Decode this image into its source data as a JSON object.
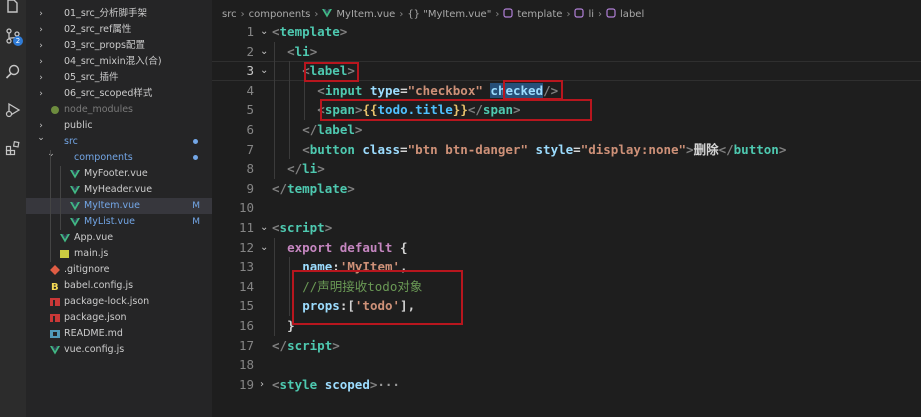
{
  "activity_bar": {
    "items": [
      {
        "name": "explorer-icon"
      },
      {
        "name": "source-control-icon",
        "badge": "2"
      },
      {
        "name": "search-icon"
      },
      {
        "name": "run-debug-icon"
      },
      {
        "name": "extensions-icon"
      }
    ]
  },
  "explorer": {
    "items": [
      {
        "label": "01_src_分析脚手架",
        "type": "folder",
        "depth": 0,
        "open": false
      },
      {
        "label": "02_src_ref属性",
        "type": "folder",
        "depth": 0,
        "open": false
      },
      {
        "label": "03_src_props配置",
        "type": "folder",
        "depth": 0,
        "open": false
      },
      {
        "label": "04_src_mixin混入(合)",
        "type": "folder",
        "depth": 0,
        "open": false
      },
      {
        "label": "05_src_插件",
        "type": "folder",
        "depth": 0,
        "open": false
      },
      {
        "label": "06_src_scoped样式",
        "type": "folder",
        "depth": 0,
        "open": false
      },
      {
        "label": "node_modules",
        "type": "node_modules",
        "depth": 0,
        "open": false,
        "dim": true
      },
      {
        "label": "public",
        "type": "folder",
        "depth": 0,
        "open": false
      },
      {
        "label": "src",
        "type": "folder",
        "depth": 0,
        "open": true,
        "color": "#73a6e6",
        "dot": true
      },
      {
        "label": "components",
        "type": "folder",
        "depth": 1,
        "open": true,
        "color": "#73a6e6",
        "dot": true
      },
      {
        "label": "MyFooter.vue",
        "type": "vue",
        "depth": 2
      },
      {
        "label": "MyHeader.vue",
        "type": "vue",
        "depth": 2
      },
      {
        "label": "MyItem.vue",
        "type": "vue",
        "depth": 2,
        "selected": true,
        "color": "#73a6e6",
        "badge": "M"
      },
      {
        "label": "MyList.vue",
        "type": "vue",
        "depth": 2,
        "color": "#73a6e6",
        "badge": "M"
      },
      {
        "label": "App.vue",
        "type": "vue",
        "depth": 1
      },
      {
        "label": "main.js",
        "type": "js",
        "depth": 1
      },
      {
        "label": ".gitignore",
        "type": "git",
        "depth": 0
      },
      {
        "label": "babel.config.js",
        "type": "babel",
        "depth": 0
      },
      {
        "label": "package-lock.json",
        "type": "npm",
        "depth": 0
      },
      {
        "label": "package.json",
        "type": "npm",
        "depth": 0
      },
      {
        "label": "README.md",
        "type": "md",
        "depth": 0
      },
      {
        "label": "vue.config.js",
        "type": "vue",
        "depth": 0
      }
    ]
  },
  "breadcrumb": {
    "parts": [
      "src",
      "components",
      "MyItem.vue",
      "{} \"MyItem.vue\"",
      "template",
      "li",
      "label"
    ]
  },
  "editor": {
    "current_line": "3",
    "lines": [
      {
        "n": "1",
        "fold": "⌄",
        "indent": 0,
        "tokens": [
          [
            "pun",
            "<"
          ],
          [
            "tag",
            "template"
          ],
          [
            "pun",
            ">"
          ]
        ]
      },
      {
        "n": "2",
        "fold": "⌄",
        "indent": 1,
        "tokens": [
          [
            "pun",
            "<"
          ],
          [
            "tag",
            "li"
          ],
          [
            "pun",
            ">"
          ]
        ]
      },
      {
        "n": "3",
        "fold": "⌄",
        "indent": 2,
        "tokens": [
          [
            "pun",
            "<"
          ],
          [
            "tag",
            "label"
          ],
          [
            "pun",
            ">"
          ]
        ]
      },
      {
        "n": "4",
        "fold": "",
        "indent": 3,
        "tokens": [
          [
            "pun",
            "<"
          ],
          [
            "tag",
            "input "
          ],
          [
            "attr",
            "type"
          ],
          [
            "wh",
            "="
          ],
          [
            "str",
            "\"checkbox\" "
          ],
          [
            "attrsel",
            "checked"
          ],
          [
            "pun",
            "/>"
          ]
        ]
      },
      {
        "n": "5",
        "fold": "",
        "indent": 3,
        "tokens": [
          [
            "pun",
            "<"
          ],
          [
            "tag",
            "span"
          ],
          [
            "pun",
            ">"
          ],
          [
            "brace",
            "{{"
          ],
          [
            "mus",
            "todo.title"
          ],
          [
            "brace",
            "}}"
          ],
          [
            "pun",
            "</"
          ],
          [
            "tag",
            "span"
          ],
          [
            "pun",
            ">"
          ]
        ]
      },
      {
        "n": "6",
        "fold": "",
        "indent": 2,
        "tokens": [
          [
            "pun",
            "</"
          ],
          [
            "tag",
            "label"
          ],
          [
            "pun",
            ">"
          ]
        ]
      },
      {
        "n": "7",
        "fold": "",
        "indent": 2,
        "tokens": [
          [
            "pun",
            "<"
          ],
          [
            "tag",
            "button "
          ],
          [
            "attr",
            "class"
          ],
          [
            "wh",
            "="
          ],
          [
            "str",
            "\"btn btn-danger\" "
          ],
          [
            "attr",
            "style"
          ],
          [
            "wh",
            "="
          ],
          [
            "str",
            "\"display:none\""
          ],
          [
            "pun",
            ">"
          ],
          [
            "wh",
            "删除"
          ],
          [
            "pun",
            "</"
          ],
          [
            "tag",
            "button"
          ],
          [
            "pun",
            ">"
          ]
        ]
      },
      {
        "n": "8",
        "fold": "",
        "indent": 1,
        "tokens": [
          [
            "pun",
            "</"
          ],
          [
            "tag",
            "li"
          ],
          [
            "pun",
            ">"
          ]
        ]
      },
      {
        "n": "9",
        "fold": "",
        "indent": 0,
        "tokens": [
          [
            "pun",
            "</"
          ],
          [
            "tag",
            "template"
          ],
          [
            "pun",
            ">"
          ]
        ]
      },
      {
        "n": "10",
        "fold": "",
        "indent": 0,
        "tokens": []
      },
      {
        "n": "11",
        "fold": "⌄",
        "indent": 0,
        "tokens": [
          [
            "pun",
            "<"
          ],
          [
            "tag",
            "script"
          ],
          [
            "pun",
            ">"
          ]
        ]
      },
      {
        "n": "12",
        "fold": "⌄",
        "indent": 1,
        "tokens": [
          [
            "kw",
            "export default "
          ],
          [
            "wh",
            "{"
          ]
        ]
      },
      {
        "n": "13",
        "fold": "",
        "indent": 2,
        "tokens": [
          [
            "prop",
            "name"
          ],
          [
            "wh",
            ":"
          ],
          [
            "str",
            "'MyItem'"
          ],
          [
            "wh",
            ","
          ]
        ]
      },
      {
        "n": "14",
        "fold": "",
        "indent": 2,
        "tokens": [
          [
            "cmt",
            "//声明接收todo对象"
          ]
        ]
      },
      {
        "n": "15",
        "fold": "",
        "indent": 2,
        "tokens": [
          [
            "prop",
            "props"
          ],
          [
            "wh",
            ":["
          ],
          [
            "str",
            "'todo'"
          ],
          [
            "wh",
            "],"
          ]
        ]
      },
      {
        "n": "16",
        "fold": "",
        "indent": 1,
        "tokens": [
          [
            "wh",
            "}"
          ]
        ]
      },
      {
        "n": "17",
        "fold": "",
        "indent": 0,
        "tokens": [
          [
            "pun",
            "</"
          ],
          [
            "tag",
            "script"
          ],
          [
            "pun",
            ">"
          ]
        ]
      },
      {
        "n": "18",
        "fold": "",
        "indent": 0,
        "tokens": []
      },
      {
        "n": "19",
        "fold": "›",
        "indent": 0,
        "tokens": [
          [
            "pun",
            "<"
          ],
          [
            "tag",
            "style "
          ],
          [
            "attr",
            "scoped"
          ],
          [
            "pun",
            ">"
          ],
          [
            "ell",
            "···"
          ]
        ]
      }
    ]
  }
}
